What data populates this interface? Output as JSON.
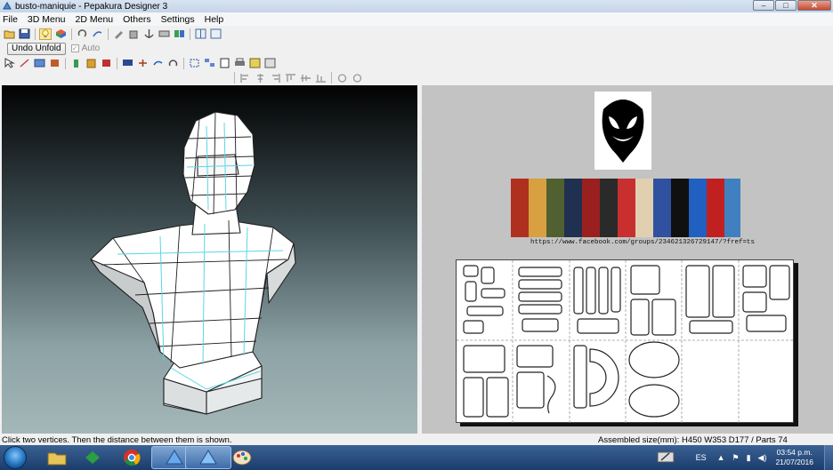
{
  "window": {
    "title": "busto-maniquie - Pepakura Designer 3",
    "buttons": {
      "minimize": "–",
      "maximize": "□",
      "close": "✕"
    }
  },
  "menu": [
    "File",
    "3D Menu",
    "2D Menu",
    "Others",
    "Settings",
    "Help"
  ],
  "toolbar2": {
    "undo_unfold": "Undo Unfold",
    "auto_label": "Auto",
    "auto_checked": true
  },
  "view2d": {
    "facebook_url": "https://www.facebook.com/groups/234621326729147/?fref=ts"
  },
  "status": {
    "hint": "Click two vertices. Then the distance between them is shown.",
    "assembled": "Assembled size(mm): H450 W353 D177 / Parts 74"
  },
  "taskbar": {
    "language": "ES",
    "time": "03:54 p.m.",
    "date": "21/07/2016",
    "apps": [
      "explorer",
      "green-app",
      "chrome",
      "pepakura",
      "pepakura-2",
      "paint"
    ]
  },
  "colors": {
    "mesh_face": "#ffffff",
    "mesh_edge": "#1f1f1f",
    "fold_line": "#5ad6e6",
    "view3d_top": "#020202",
    "view3d_bottom": "#a4b7b9"
  }
}
